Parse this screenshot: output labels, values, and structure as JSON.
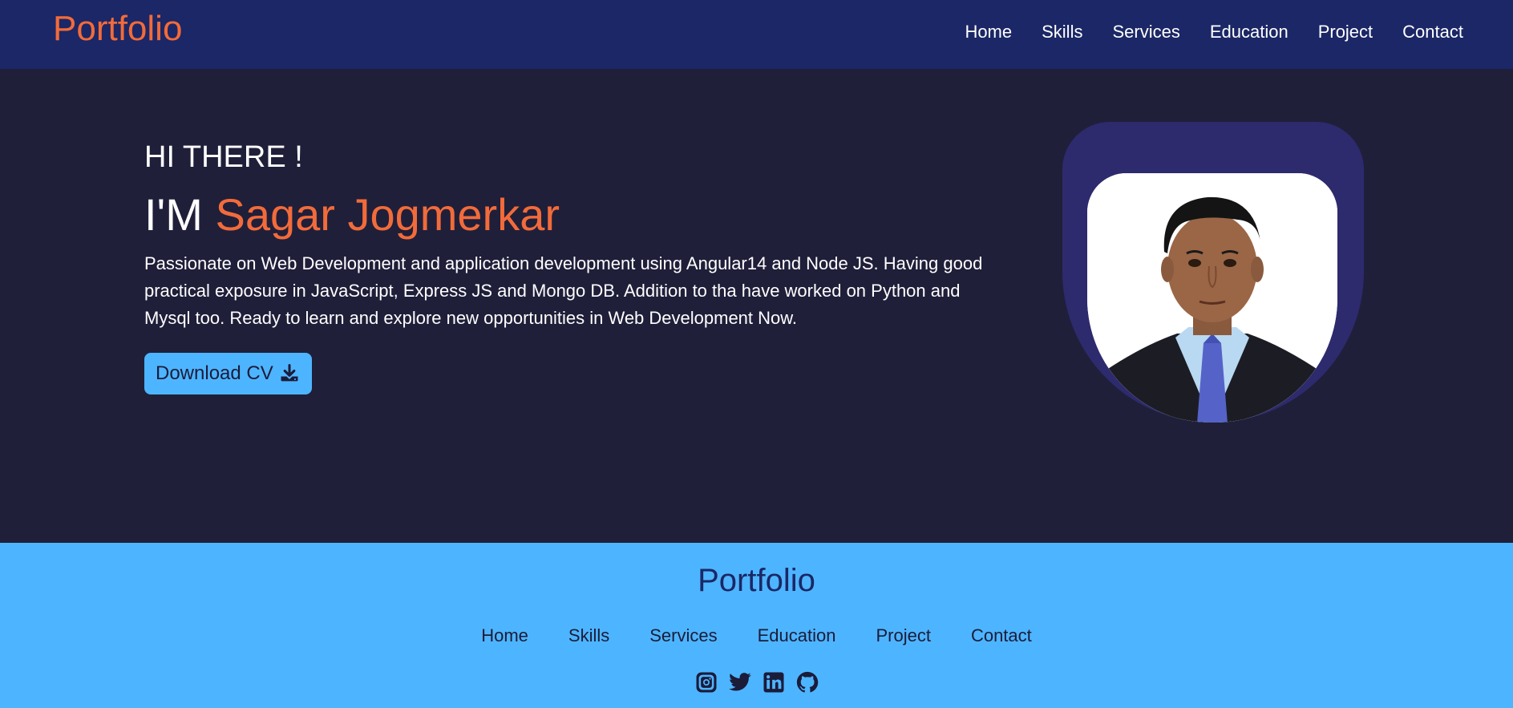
{
  "nav": {
    "logo": "Portfolio",
    "links": [
      "Home",
      "Skills",
      "Services",
      "Education",
      "Project",
      "Contact"
    ]
  },
  "hero": {
    "greeting": "HI THERE !",
    "intro_prefix": "I'M",
    "name": "Sagar Jogmerkar",
    "description": "Passionate on Web Development and application development using Angular14 and Node JS. Having good practical exposure in JavaScript, Express JS and Mongo DB. Addition to tha have worked on Python and Mysql too. Ready to learn and explore new opportunities in Web Development Now.",
    "download_label": "Download CV",
    "download_icon": "download-icon",
    "photo": "profile-photo"
  },
  "footer": {
    "logo": "Portfolio",
    "links": [
      "Home",
      "Skills",
      "Services",
      "Education",
      "Project",
      "Contact"
    ],
    "socials": [
      "instagram-icon",
      "twitter-icon",
      "linkedin-icon",
      "github-icon"
    ]
  },
  "colors": {
    "navbar": "#1b2766",
    "hero_bg": "#1f1f3a",
    "accent": "#f26b3a",
    "footer_bg": "#4db5ff",
    "button_bg": "#4db5ff",
    "photo_frame": "#2e2a6e"
  }
}
